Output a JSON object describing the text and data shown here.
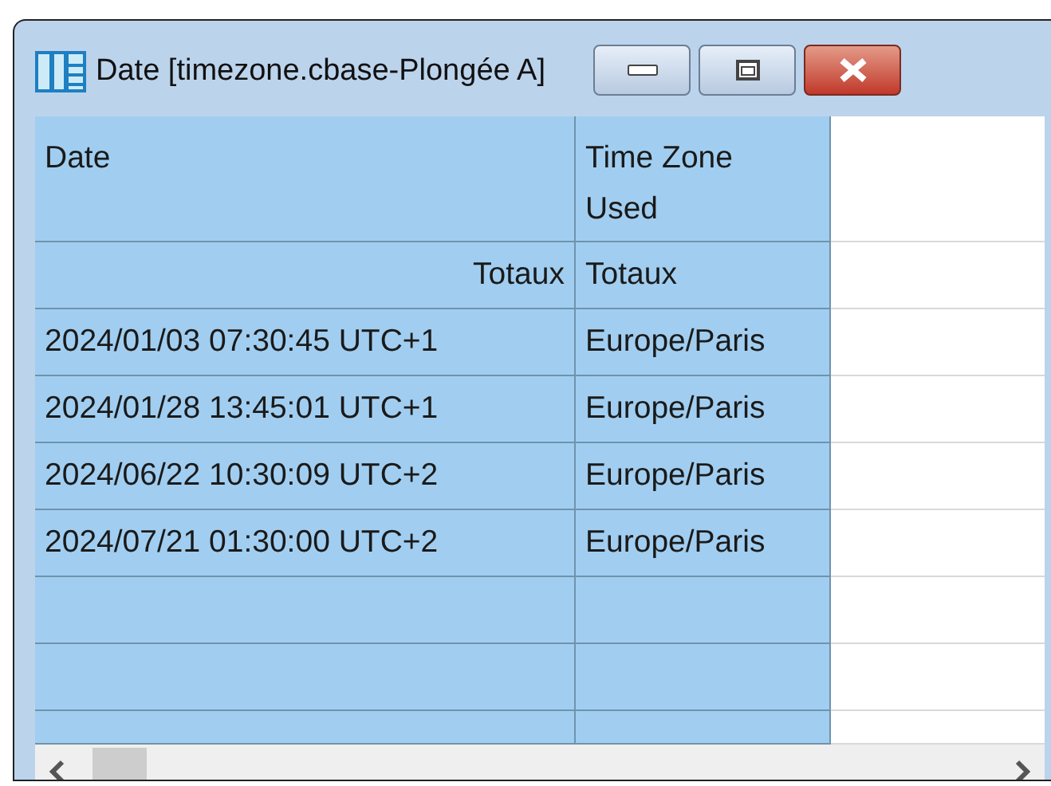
{
  "window": {
    "title": "Date [timezone.cbase-Plongée A]"
  },
  "table": {
    "columns": [
      "Date",
      "Time Zone Used"
    ],
    "totals": [
      "Totaux",
      "Totaux"
    ],
    "rows": [
      [
        "2024/01/03 07:30:45 UTC+1",
        "Europe/Paris"
      ],
      [
        "2024/01/28 13:45:01 UTC+1",
        "Europe/Paris"
      ],
      [
        "2024/06/22 10:30:09 UTC+2",
        "Europe/Paris"
      ],
      [
        "2024/07/21 01:30:00 UTC+2",
        "Europe/Paris"
      ]
    ]
  }
}
